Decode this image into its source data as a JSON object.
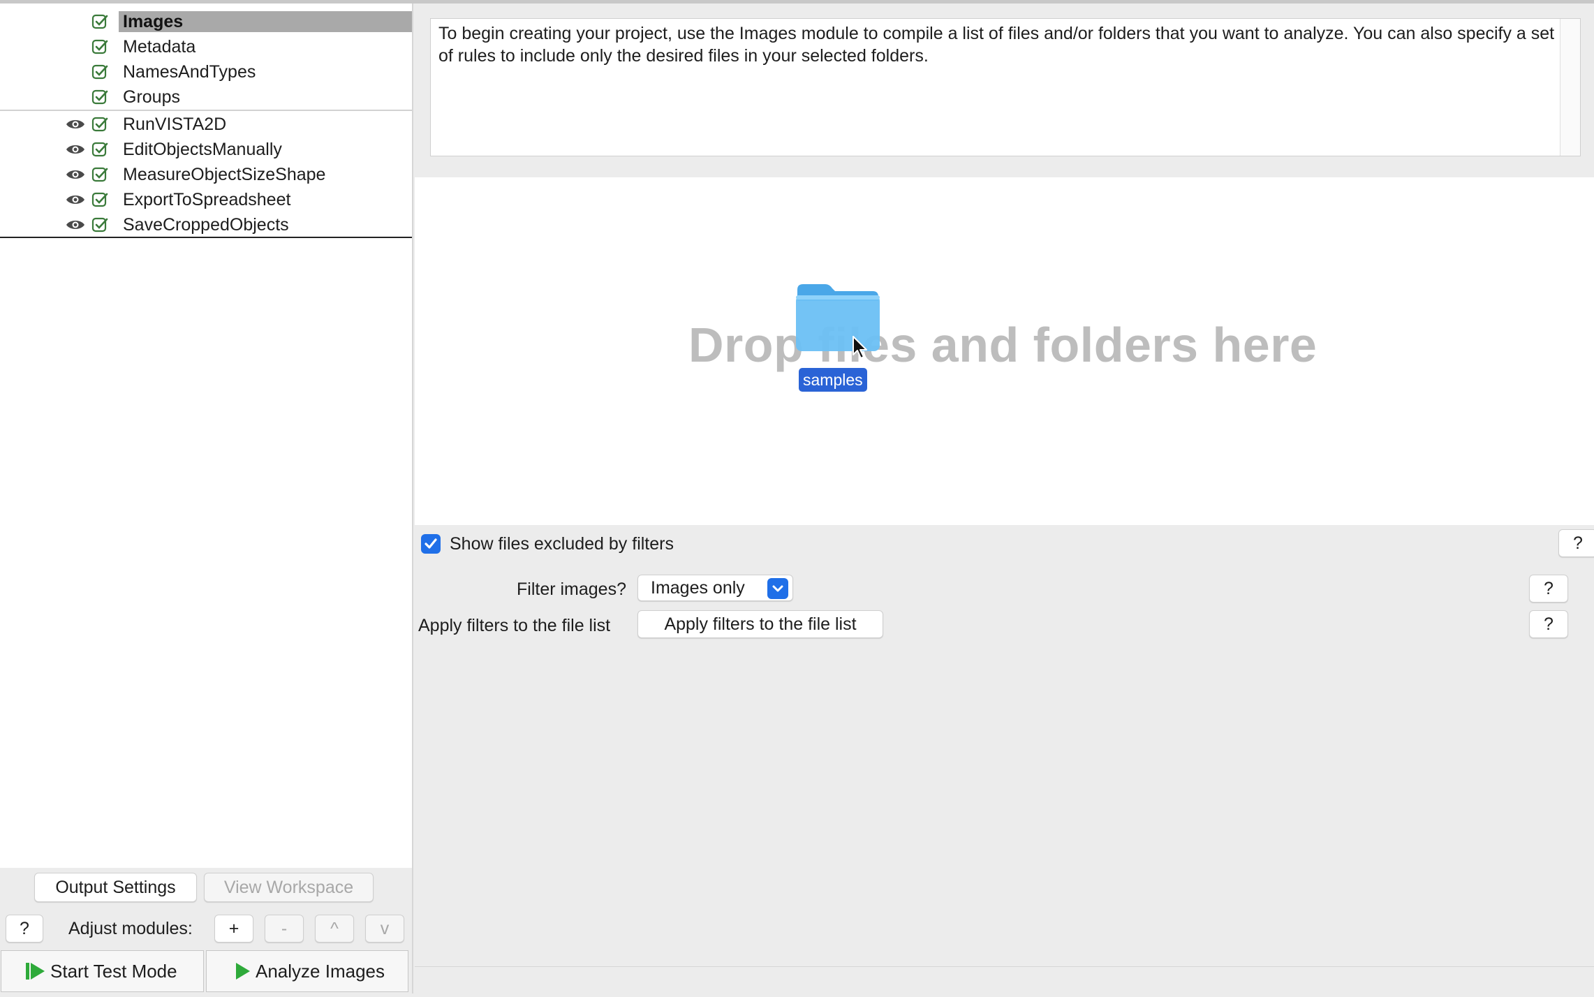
{
  "pipeline": {
    "input_modules": [
      {
        "name": "Images",
        "selected": true
      },
      {
        "name": "Metadata"
      },
      {
        "name": "NamesAndTypes"
      },
      {
        "name": "Groups"
      }
    ],
    "analysis_modules": [
      {
        "name": "RunVISTA2D"
      },
      {
        "name": "EditObjectsManually"
      },
      {
        "name": "MeasureObjectSizeShape"
      },
      {
        "name": "ExportToSpreadsheet"
      },
      {
        "name": "SaveCroppedObjects"
      }
    ]
  },
  "left_controls": {
    "output_settings": "Output Settings",
    "view_workspace": "View Workspace",
    "help": "?",
    "adjust_modules_label": "Adjust modules:",
    "add": "+",
    "remove": "-",
    "move_up": "^",
    "move_down": "v",
    "start_test_mode": "Start Test Mode",
    "analyze_images": "Analyze Images"
  },
  "help_text": "To begin creating your project, use the Images module to compile a list of files and/or folders that you want to analyze. You can also specify a set of rules to include only the desired files in your selected folders.",
  "drop_zone": {
    "text": "Drop files and folders here",
    "dragged_item_label": "samples"
  },
  "settings": {
    "show_excluded_label": "Show files excluded by filters",
    "show_excluded_checked": true,
    "filter_images_label": "Filter images?",
    "filter_images_value": "Images only",
    "apply_filters_label": "Apply filters to the file list",
    "apply_filters_button": "Apply filters to the file list",
    "help": "?"
  },
  "colors": {
    "accent": "#1f6fe8",
    "selection": "#a9a9a9",
    "folder_label_bg": "#2a63d6",
    "run_green": "#2eaa3a"
  }
}
